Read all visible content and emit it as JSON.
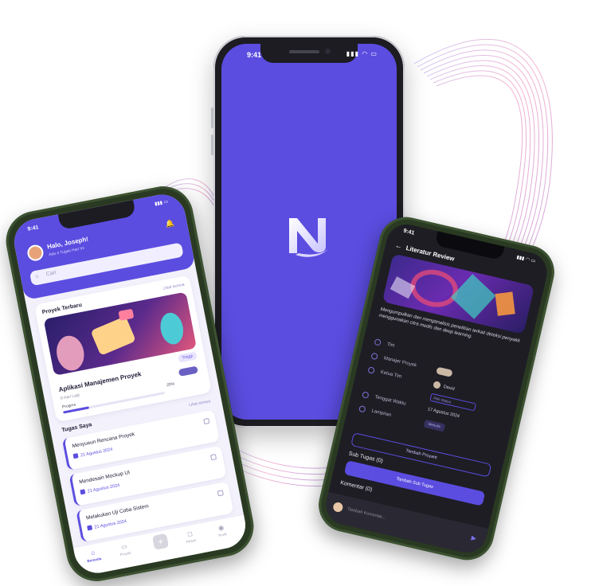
{
  "colors": {
    "brand": "#5b4de0",
    "dark_screen": "#1e1d24",
    "phone_frame": "#2a3a22"
  },
  "center_phone": {
    "status_time": "9:41",
    "status_icons": "▮▮▮ ◠ ▭",
    "logo_icon": "brand-n-logo-icon"
  },
  "left_phone": {
    "status_time": "9:41",
    "status_icons": "▮▮▮ ▭",
    "greeting": "Halo, Joseph!",
    "greeting_sub": "Ada 4 Tugas Hari Ini",
    "bell_icon": "🔔",
    "search_placeholder": "Cari",
    "recent_projects": {
      "title": "Proyek Terbaru",
      "see_all": "Lihat semua",
      "badge": "Tinggi",
      "project_name": "Aplikasi Manajemen Proyek",
      "days_left": "6 Hari Lagi",
      "progress_label": "Progres",
      "progress_pct": "25%",
      "progress_value": 0.25
    },
    "my_tasks": {
      "title": "Tugas Saya",
      "see_all": "Lihat semua",
      "items": [
        {
          "title": "Menyusun Rencana Proyek",
          "date": "21 Agustus 2024"
        },
        {
          "title": "Mendesain Mockup UI",
          "date": "21 Agustus 2024"
        },
        {
          "title": "Melakukan Uji Coba Sistem",
          "date": "21 Agustus 2024"
        }
      ]
    },
    "nav": {
      "home": "Beranda",
      "projects": "Proyek",
      "add": "+",
      "messages": "Pesan",
      "profile": "Profil"
    }
  },
  "right_phone": {
    "status_time": "9:41",
    "status_icons": "▮▮▮ ◠ ▭",
    "back": "←",
    "title": "Literatur Review",
    "description": "Mengumpulkan dan menganalisis penelitian terkait deteksi penyakit menggunakan citra medis dan deep learning.",
    "details": {
      "team_label": "Tim",
      "manager_label": "Manajer Proyek",
      "lead_label": "Ketua Tim",
      "lead_name": "David",
      "deadline_label": "Tenggat Waktu",
      "deadline_value": "17 Agustus 2024",
      "select_status": "Pilih Status",
      "attachment_label": "Lampiran",
      "attachment_tag": "Menulis"
    },
    "add_attachment": "Tambah Proyant",
    "subtasks_title": "Sub Tugas (0)",
    "add_subtask": "Tambah Sub Tugas",
    "comments_title": "Komentar (0)",
    "comment_placeholder": "Tambah Komentar..."
  }
}
